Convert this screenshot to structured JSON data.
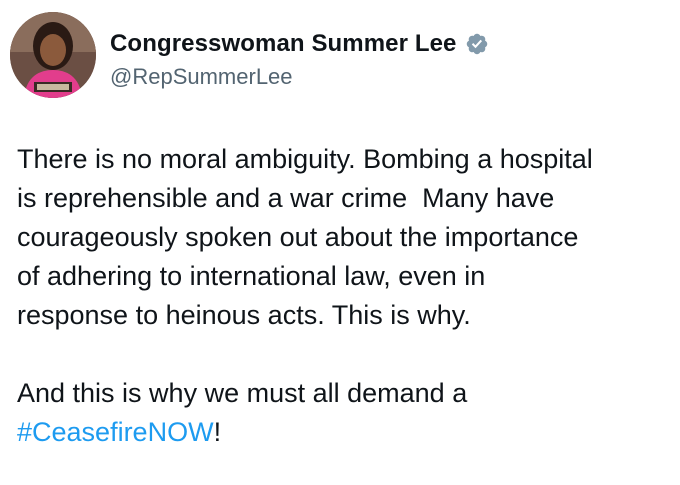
{
  "author": {
    "display_name": "Congresswoman Summer Lee",
    "handle": "@RepSummerLee",
    "verified": true,
    "verified_color": "#829aab",
    "avatar_icon": "profile-photo",
    "nameplate_text": "MS. LEE"
  },
  "tweet": {
    "paragraph1": "There is no moral ambiguity. Bombing a hospital\nis reprehensible and a war crime  Many have\ncourageously spoken out about the importance\nof adhering to international law, even in\nresponse to heinous acts. This is why.",
    "paragraph2_text": "And this is why we must all demand a\n",
    "hashtag": "#CeasefireNOW",
    "paragraph2_end": "!",
    "hashtag_color": "#1d9bf0"
  }
}
